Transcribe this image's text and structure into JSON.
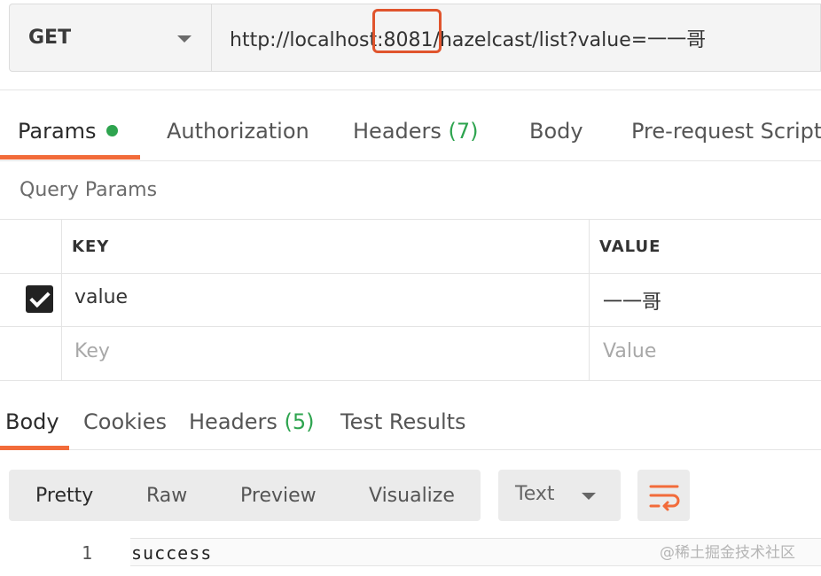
{
  "request": {
    "method": "GET",
    "url": "http://localhost:8081/hazelcast/list?value=一一哥"
  },
  "request_tabs": {
    "params": "Params",
    "authorization": "Authorization",
    "headers": "Headers",
    "headers_count": "(7)",
    "body": "Body",
    "prerequest": "Pre-request Script"
  },
  "query_params": {
    "title": "Query Params",
    "key_header": "KEY",
    "value_header": "VALUE",
    "rows": [
      {
        "key": "value",
        "value": "一一哥",
        "checked": true
      }
    ],
    "placeholder_key": "Key",
    "placeholder_value": "Value"
  },
  "response_tabs": {
    "body": "Body",
    "cookies": "Cookies",
    "headers": "Headers",
    "headers_count": "(5)",
    "test_results": "Test Results"
  },
  "view_options": {
    "pretty": "Pretty",
    "raw": "Raw",
    "preview": "Preview",
    "visualize": "Visualize",
    "format": "Text"
  },
  "response_body": {
    "line_number": "1",
    "content": "success"
  },
  "watermark": "@稀土掘金技术社区",
  "colors": {
    "accent": "#f26b3a",
    "highlight": "#e0542d",
    "success": "#2ea44f"
  }
}
